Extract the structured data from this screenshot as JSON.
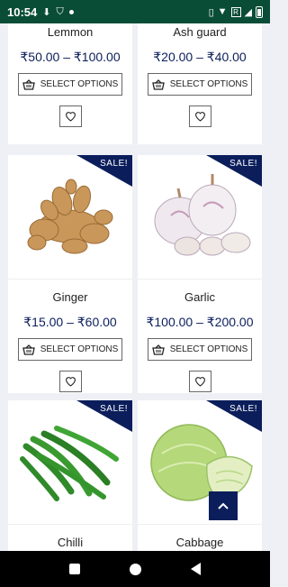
{
  "status_bar": {
    "time": "10:54",
    "badge": "R"
  },
  "products": [
    {
      "name": "Lemmon",
      "price": "₹50.00 – ₹100.00",
      "button_label": "SELECT OPTIONS",
      "sale": false
    },
    {
      "name": "Ash guard",
      "price": "₹20.00 – ₹40.00",
      "button_label": "SELECT OPTIONS",
      "sale": false
    },
    {
      "name": "Ginger",
      "price": "₹15.00 – ₹60.00",
      "button_label": "SELECT OPTIONS",
      "sale": true,
      "sale_label": "SALE!",
      "image_icon": "ginger-image"
    },
    {
      "name": "Garlic",
      "price": "₹100.00 – ₹200.00",
      "button_label": "SELECT OPTIONS",
      "sale": true,
      "sale_label": "SALE!",
      "image_icon": "garlic-image"
    },
    {
      "name": "Chilli",
      "sale": true,
      "sale_label": "SALE!",
      "image_icon": "chilli-image"
    },
    {
      "name": "Cabbage",
      "sale": true,
      "sale_label": "SALE!",
      "image_icon": "cabbage-image"
    }
  ],
  "colors": {
    "status_bar": "#0a4d36",
    "accent": "#0b1e5b",
    "background": "#eef0f5"
  }
}
